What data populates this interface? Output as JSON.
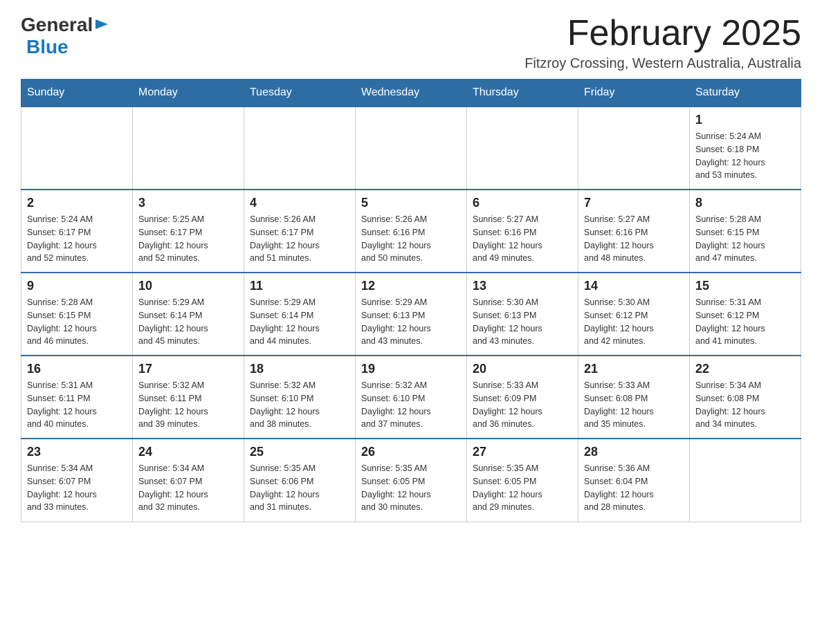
{
  "header": {
    "month_title": "February 2025",
    "location": "Fitzroy Crossing, Western Australia, Australia",
    "logo_general": "General",
    "logo_blue": "Blue"
  },
  "days_of_week": [
    "Sunday",
    "Monday",
    "Tuesday",
    "Wednesday",
    "Thursday",
    "Friday",
    "Saturday"
  ],
  "weeks": [
    {
      "days": [
        {
          "number": "",
          "info": ""
        },
        {
          "number": "",
          "info": ""
        },
        {
          "number": "",
          "info": ""
        },
        {
          "number": "",
          "info": ""
        },
        {
          "number": "",
          "info": ""
        },
        {
          "number": "",
          "info": ""
        },
        {
          "number": "1",
          "info": "Sunrise: 5:24 AM\nSunset: 6:18 PM\nDaylight: 12 hours\nand 53 minutes."
        }
      ]
    },
    {
      "days": [
        {
          "number": "2",
          "info": "Sunrise: 5:24 AM\nSunset: 6:17 PM\nDaylight: 12 hours\nand 52 minutes."
        },
        {
          "number": "3",
          "info": "Sunrise: 5:25 AM\nSunset: 6:17 PM\nDaylight: 12 hours\nand 52 minutes."
        },
        {
          "number": "4",
          "info": "Sunrise: 5:26 AM\nSunset: 6:17 PM\nDaylight: 12 hours\nand 51 minutes."
        },
        {
          "number": "5",
          "info": "Sunrise: 5:26 AM\nSunset: 6:16 PM\nDaylight: 12 hours\nand 50 minutes."
        },
        {
          "number": "6",
          "info": "Sunrise: 5:27 AM\nSunset: 6:16 PM\nDaylight: 12 hours\nand 49 minutes."
        },
        {
          "number": "7",
          "info": "Sunrise: 5:27 AM\nSunset: 6:16 PM\nDaylight: 12 hours\nand 48 minutes."
        },
        {
          "number": "8",
          "info": "Sunrise: 5:28 AM\nSunset: 6:15 PM\nDaylight: 12 hours\nand 47 minutes."
        }
      ]
    },
    {
      "days": [
        {
          "number": "9",
          "info": "Sunrise: 5:28 AM\nSunset: 6:15 PM\nDaylight: 12 hours\nand 46 minutes."
        },
        {
          "number": "10",
          "info": "Sunrise: 5:29 AM\nSunset: 6:14 PM\nDaylight: 12 hours\nand 45 minutes."
        },
        {
          "number": "11",
          "info": "Sunrise: 5:29 AM\nSunset: 6:14 PM\nDaylight: 12 hours\nand 44 minutes."
        },
        {
          "number": "12",
          "info": "Sunrise: 5:29 AM\nSunset: 6:13 PM\nDaylight: 12 hours\nand 43 minutes."
        },
        {
          "number": "13",
          "info": "Sunrise: 5:30 AM\nSunset: 6:13 PM\nDaylight: 12 hours\nand 43 minutes."
        },
        {
          "number": "14",
          "info": "Sunrise: 5:30 AM\nSunset: 6:12 PM\nDaylight: 12 hours\nand 42 minutes."
        },
        {
          "number": "15",
          "info": "Sunrise: 5:31 AM\nSunset: 6:12 PM\nDaylight: 12 hours\nand 41 minutes."
        }
      ]
    },
    {
      "days": [
        {
          "number": "16",
          "info": "Sunrise: 5:31 AM\nSunset: 6:11 PM\nDaylight: 12 hours\nand 40 minutes."
        },
        {
          "number": "17",
          "info": "Sunrise: 5:32 AM\nSunset: 6:11 PM\nDaylight: 12 hours\nand 39 minutes."
        },
        {
          "number": "18",
          "info": "Sunrise: 5:32 AM\nSunset: 6:10 PM\nDaylight: 12 hours\nand 38 minutes."
        },
        {
          "number": "19",
          "info": "Sunrise: 5:32 AM\nSunset: 6:10 PM\nDaylight: 12 hours\nand 37 minutes."
        },
        {
          "number": "20",
          "info": "Sunrise: 5:33 AM\nSunset: 6:09 PM\nDaylight: 12 hours\nand 36 minutes."
        },
        {
          "number": "21",
          "info": "Sunrise: 5:33 AM\nSunset: 6:08 PM\nDaylight: 12 hours\nand 35 minutes."
        },
        {
          "number": "22",
          "info": "Sunrise: 5:34 AM\nSunset: 6:08 PM\nDaylight: 12 hours\nand 34 minutes."
        }
      ]
    },
    {
      "days": [
        {
          "number": "23",
          "info": "Sunrise: 5:34 AM\nSunset: 6:07 PM\nDaylight: 12 hours\nand 33 minutes."
        },
        {
          "number": "24",
          "info": "Sunrise: 5:34 AM\nSunset: 6:07 PM\nDaylight: 12 hours\nand 32 minutes."
        },
        {
          "number": "25",
          "info": "Sunrise: 5:35 AM\nSunset: 6:06 PM\nDaylight: 12 hours\nand 31 minutes."
        },
        {
          "number": "26",
          "info": "Sunrise: 5:35 AM\nSunset: 6:05 PM\nDaylight: 12 hours\nand 30 minutes."
        },
        {
          "number": "27",
          "info": "Sunrise: 5:35 AM\nSunset: 6:05 PM\nDaylight: 12 hours\nand 29 minutes."
        },
        {
          "number": "28",
          "info": "Sunrise: 5:36 AM\nSunset: 6:04 PM\nDaylight: 12 hours\nand 28 minutes."
        },
        {
          "number": "",
          "info": ""
        }
      ]
    }
  ]
}
